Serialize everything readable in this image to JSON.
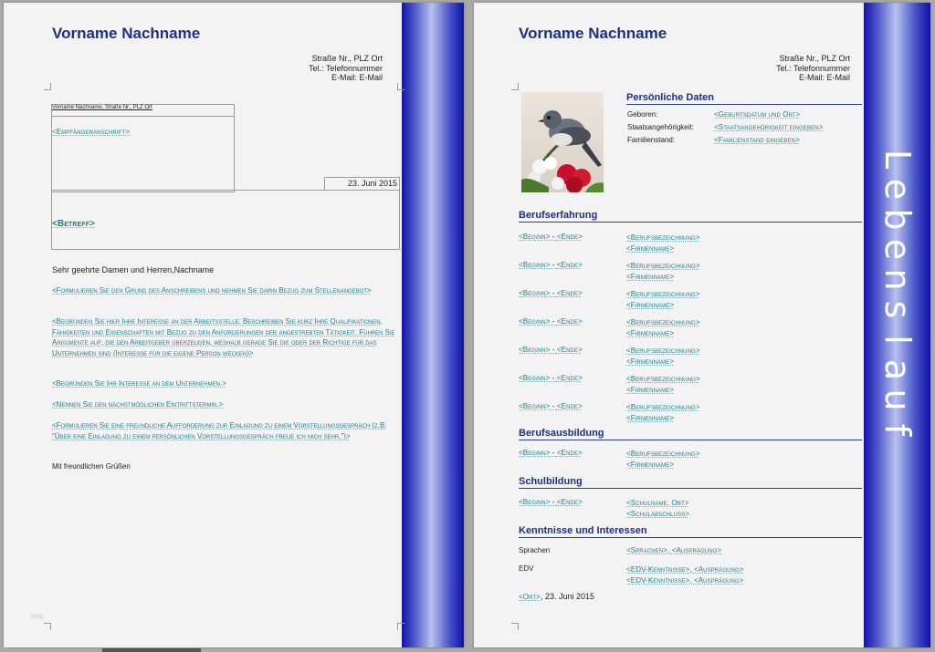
{
  "letter": {
    "name": "Vorname Nachname",
    "address_lines": [
      "Straße Nr., PLZ Ort",
      "Tel.: Telefonnummer",
      "E-Mail: E-Mail"
    ],
    "sender_line": "Vorname Nachname, Straße Nr., PLZ Ort",
    "recipient": "<Empfängeranschrift>",
    "date": "23. Juni 2015",
    "subject": "<Betreff>",
    "salutation": "Sehr geehrte Damen und Herren,Nachname",
    "paragraphs": [
      "<Formulieren Sie den Grund des Anschreibens und nehmen Sie darin Bezug zum Stellenangebot>",
      "<Begründen Sie hier Ihre Interesse an der Arbeitsstelle: Beschreiben Sie kurz Ihre Qualifikationen, Fähigkeiten und Eigenschaften mit Bezug zu den Anforderungen der angestrebten Tätigkeit. Führen Sie Argumente auf, die den Arbeitgeber überzeugen, weshalb gerade Sie die oder der Richtige für das Unternehmen sind (Interesse für die eigene Person wecken)>",
      "<Begründen Sie Ihr Interesse an dem Unternehmen.>",
      "<Nennen Sie den nächstmöglichen Eintrittstermin.>",
      "<Formulieren Sie eine freundliche Aufforderung zur Einladung zu einem Vorstellungsgespräch (z.B. \"Über eine Einladung zu einem persönlichen Vorstellungsgespräch freue ich mich sehr.\")>"
    ],
    "closing": "Mit freundlichen Grüßen",
    "watermark": "blog"
  },
  "cv": {
    "name": "Vorname Nachname",
    "address_lines": [
      "Straße Nr., PLZ Ort",
      "Tel.: Telefonnummer",
      "E-Mail: E-Mail"
    ],
    "side_title": "Lebenslauf",
    "personal": {
      "title": "Persönliche Daten",
      "rows": [
        {
          "label": "Geboren:",
          "value": "<Geburtsdatum und Ort>"
        },
        {
          "label": "Staatsangehörigkeit:",
          "value": "<Staatsangehörigkeit eingeben>"
        },
        {
          "label": "Familienstand:",
          "value": "<Familienstand eingeben>"
        }
      ]
    },
    "experience": {
      "title": "Berufserfahrung",
      "entries": [
        {
          "start": "<Beginn>",
          "end": "<Ende>",
          "line1": "<Berufsbezeichnung>",
          "line2": "<Firmenname>"
        },
        {
          "start": "<Beginn>",
          "end": "<Ende>",
          "line1": "<Berufsbezeichnung>",
          "line2": "<Firmenname>"
        },
        {
          "start": "<Beginn>",
          "end": "<Ende>",
          "line1": "<Berufsbezeichnung>",
          "line2": "<Firmenname>"
        },
        {
          "start": "<Beginn>",
          "end": "<Ende>",
          "line1": "<Berufsbezeichnung>",
          "line2": "<Firmenname>"
        },
        {
          "start": "<Beginn>",
          "end": "<Ende>",
          "line1": "<Berufsbezeichnung>",
          "line2": "<Firmenname>"
        },
        {
          "start": "<Beginn>",
          "end": "<Ende>",
          "line1": "<Berufsbezeichnung>",
          "line2": "<Firmenname>"
        },
        {
          "start": "<Beginn>",
          "end": "<Ende>",
          "line1": "<Berufsbezeichnung>",
          "line2": "<Firmenname>"
        }
      ]
    },
    "training": {
      "title": "Berufsausbildung",
      "entries": [
        {
          "start": "<Beginn>",
          "end": "<Ende>",
          "line1": "<Berufsbezeichnung>",
          "line2": "<Firmenname>"
        }
      ]
    },
    "school": {
      "title": "Schulbildung",
      "entries": [
        {
          "start": "<Beginn>",
          "end": "<Ende>",
          "line1": "<Schulname, Ort>",
          "line2": "<Schulabschluss>"
        }
      ]
    },
    "skills": {
      "title": "Kenntnisse und Interessen",
      "languages_label": "Sprachen",
      "languages_value": "<Sprachen>",
      "languages_level": "<Ausprägung>",
      "it_label": "EDV",
      "it_values": [
        {
          "skill": "<EDV-Kenntnisse>",
          "level": "<Ausprägung>"
        },
        {
          "skill": "<EDV-Kenntnisse>",
          "level": "<Ausprägung>"
        }
      ]
    },
    "place": "<Ort>",
    "date": "23. Juni 2015",
    "separator": " - ",
    "comma": ", "
  }
}
